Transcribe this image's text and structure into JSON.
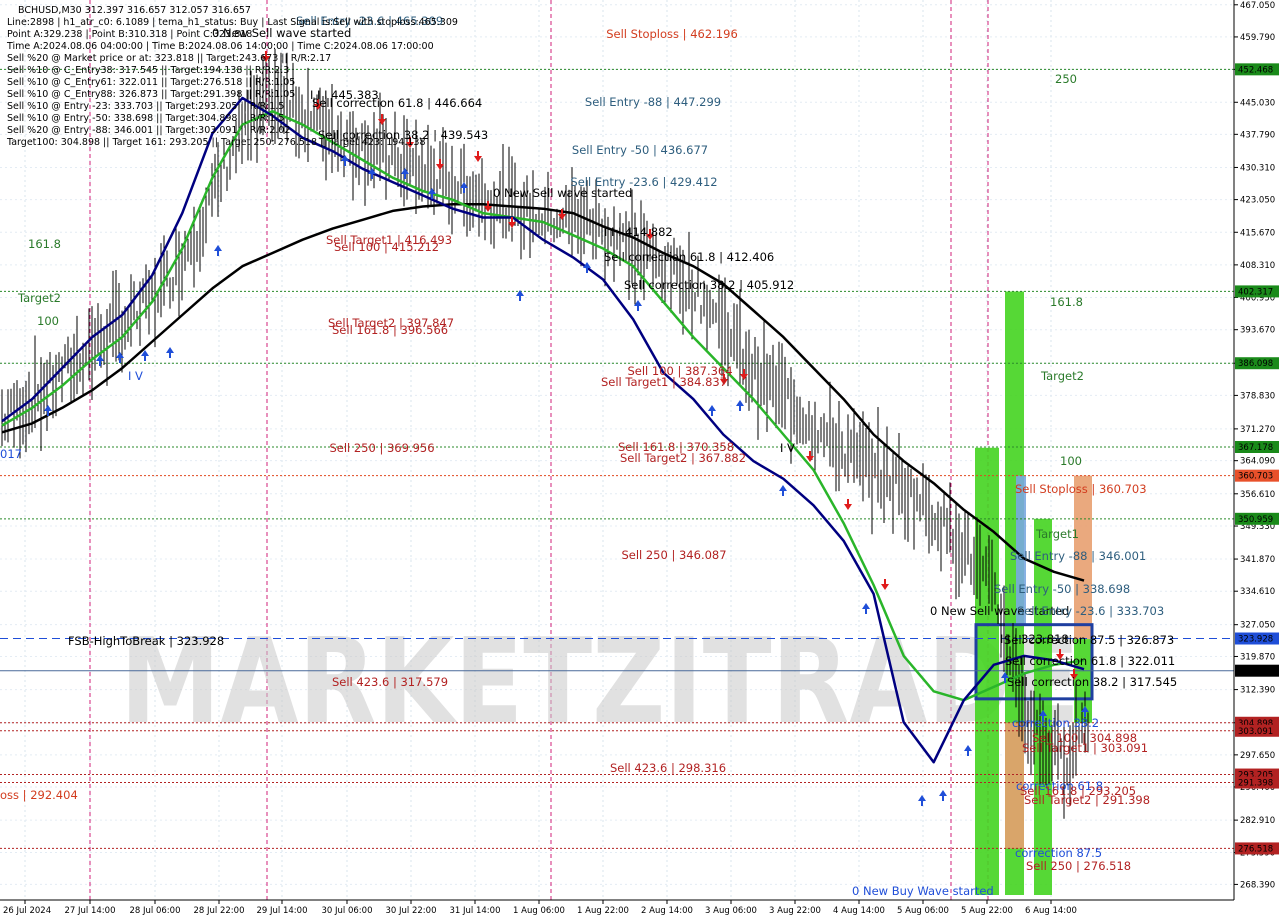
{
  "symbol_header": "BCHUSD,M30  312.397 316.657 312.057 316.657",
  "info_lines": [
    "Line:2898 | h1_atr_c0: 6.1089 | tema_h1_status: Buy | Last Signal is:Sell with stoploss:465.309",
    "Point A:329.238 | Point B:310.318 | Point C:323.818",
    "Time A:2024.08.06 04:00:00 | Time B:2024.08.06 14:00:00 | Time C:2024.08.06 17:00:00",
    "Sell %20 @ Market price or at: 323.818 || Target:243.673 || R/R:2.17",
    "Sell %10 @ C_Entry38: 317.545 || Target:194.138 || R/R:2.3",
    "Sell %10 @ C_Entry61: 322.011 || Target:276.518 || R/R:1.05",
    "Sell %10 @ C_Entry88: 326.873 || Target:291.398 || R/R:1.05",
    "Sell %10 @ Entry -23: 333.703 || Target:293.205 || R/R:1.5",
    "Sell %10 @ Entry -50: 338.698 || Target:304.898 || R/R:1.5",
    "Sell %20 @ Entry -88: 346.001 || Target:303.091 || R/R:2.02",
    "Target100: 304.898 || Target 161: 293.205 || Target 250: 276.518 || Target 423: 194.138"
  ],
  "chart_data": {
    "type": "line",
    "symbol": "BCHUSD",
    "timeframe": "M30",
    "ylim": [
      266,
      467
    ],
    "x_categories": [
      "26 Jul 2024",
      "27 Jul 14:00",
      "28 Jul 06:00",
      "28 Jul 22:00",
      "29 Jul 14:00",
      "30 Jul 06:00",
      "30 Jul 22:00",
      "31 Jul 14:00",
      "1 Aug 06:00",
      "1 Aug 22:00",
      "2 Aug 14:00",
      "3 Aug 06:00",
      "3 Aug 22:00",
      "4 Aug 14:00",
      "5 Aug 06:00",
      "5 Aug 22:00",
      "6 Aug 14:00"
    ],
    "y_ticks": [
      "467.050",
      "459.790",
      "452.460",
      "445.030",
      "437.790",
      "430.310",
      "423.050",
      "415.670",
      "408.310",
      "400.950",
      "393.670",
      "386.098",
      "378.830",
      "371.270",
      "364.090",
      "356.610",
      "349.330",
      "341.870",
      "334.610",
      "327.050",
      "319.870",
      "312.390",
      "304.898",
      "297.650",
      "290.400",
      "282.910",
      "275.590",
      "268.390"
    ],
    "series": [
      {
        "name": "",
        "color": "#000000",
        "y": [
          370.5,
          372.5,
          376,
          380,
          385,
          391,
          397,
          403,
          408,
          411,
          414,
          416.5,
          418.5,
          420.5,
          421.5,
          422,
          422,
          421.5,
          421,
          420,
          417,
          414.5,
          411,
          408,
          404,
          398,
          392,
          385,
          378,
          370,
          364,
          359,
          353,
          348,
          342,
          339,
          337
        ]
      },
      {
        "name": "",
        "color": "#2ab52a",
        "y": [
          372,
          376,
          381,
          387,
          392,
          400,
          412,
          428,
          440,
          443,
          440,
          436,
          432,
          428,
          425,
          423,
          420,
          419,
          418,
          415,
          412,
          408,
          400,
          392,
          385,
          378,
          370,
          362,
          350,
          336,
          320,
          312,
          310,
          313,
          316,
          318,
          319
        ]
      },
      {
        "name": "",
        "color": "#000080",
        "y": [
          373,
          378,
          385,
          392,
          397,
          406,
          420,
          438,
          446,
          442,
          437,
          434,
          430,
          427,
          424,
          421,
          419,
          419,
          414,
          410,
          405,
          396,
          384,
          378,
          370,
          364,
          360,
          354,
          346,
          334,
          305,
          296,
          310,
          318,
          320,
          319,
          317
        ]
      }
    ],
    "right_price_labels": [
      {
        "value": "452.468",
        "color": "#1a8a1a"
      },
      {
        "value": "402.317",
        "color": "#1a8a1a"
      },
      {
        "value": "386.098",
        "color": "#1a8a1a"
      },
      {
        "value": "367.178",
        "color": "#1a8a1a"
      },
      {
        "value": "360.703",
        "color": "#e8502a"
      },
      {
        "value": "350.959",
        "color": "#1a8a1a"
      },
      {
        "value": "323.928",
        "color": "#1f4ed8"
      },
      {
        "value": "316.657",
        "color": "#000000"
      },
      {
        "value": "304.898",
        "color": "#b22222"
      },
      {
        "value": "303.091",
        "color": "#b22222"
      },
      {
        "value": "293.205",
        "color": "#b22222"
      },
      {
        "value": "291.398",
        "color": "#b22222"
      },
      {
        "value": "276.518",
        "color": "#b22222"
      }
    ],
    "annotations": [
      {
        "text": "Sell Entry -23.6 | 465.309",
        "color": "#2e5e7e"
      },
      {
        "text": "0 New Sell wave started",
        "color": "#000000"
      },
      {
        "text": "Sell Stoploss | 462.196",
        "color": "#d23c1e"
      },
      {
        "text": "250",
        "color": "#2a7a2a"
      },
      {
        "text": "Sell Entry -88 | 447.299",
        "color": "#2e5e7e"
      },
      {
        "text": "I I I 445.383",
        "color": "#000000"
      },
      {
        "text": "Sell correction 61.8 | 446.664",
        "color": "#000000"
      },
      {
        "text": "Sell correction 38.2 | 439.543",
        "color": "#000000"
      },
      {
        "text": "Sell Entry -50 | 436.677",
        "color": "#2e5e7e"
      },
      {
        "text": "Sell Entry -23.6 | 429.412",
        "color": "#2e5e7e"
      },
      {
        "text": "0 New Sell wave started",
        "color": "#000000"
      },
      {
        "text": "I I I 414.882",
        "color": "#000000"
      },
      {
        "text": "Sell Target1 | 416.493",
        "color": "#b22222"
      },
      {
        "text": "Sell 100 | 415.212",
        "color": "#b22222"
      },
      {
        "text": "Sell correction 61.8 | 412.406",
        "color": "#000000"
      },
      {
        "text": "Sell correction 38.2 | 405.912",
        "color": "#000000"
      },
      {
        "text": "161.8",
        "color": "#2a7a2a"
      },
      {
        "text": "Target2",
        "color": "#2a7a2a"
      },
      {
        "text": "100",
        "color": "#2a7a2a"
      },
      {
        "text": "Sell Target2 | 397.847",
        "color": "#b22222"
      },
      {
        "text": "Sell 161.8 | 396.566",
        "color": "#b22222"
      },
      {
        "text": "I V",
        "color": "#1f4ed8"
      },
      {
        "text": "Sell 100 | 387.364",
        "color": "#b22222"
      },
      {
        "text": "Sell Target1 | 384.837",
        "color": "#b22222"
      },
      {
        "text": "Sell 250 | 369.956",
        "color": "#b22222"
      },
      {
        "text": "Sell 161.8 | 370.358",
        "color": "#b22222"
      },
      {
        "text": "Sell Target2 | 367.882",
        "color": "#b22222"
      },
      {
        "text": "I V",
        "color": "#000000"
      },
      {
        "text": "161.8",
        "color": "#2a7a2a"
      },
      {
        "text": "Target2",
        "color": "#2a7a2a"
      },
      {
        "text": "100",
        "color": "#2a7a2a"
      },
      {
        "text": "Sell Stoploss | 360.703",
        "color": "#d23c1e"
      },
      {
        "text": "Target1",
        "color": "#2a7a2a"
      },
      {
        "text": "Sell 250 | 346.087",
        "color": "#b22222"
      },
      {
        "text": "Sell Entry -88 | 346.001",
        "color": "#2e5e7e"
      },
      {
        "text": "Sell Entry -50 | 338.698",
        "color": "#2e5e7e"
      },
      {
        "text": "0 New Sell wave started",
        "color": "#000000"
      },
      {
        "text": "Sell Entry -23.6 | 333.703",
        "color": "#2e5e7e"
      },
      {
        "text": "FSB-HighToBreak | 323.928",
        "color": "#000000"
      },
      {
        "text": "I I I 323.818",
        "color": "#000000"
      },
      {
        "text": "Sell correction 87.5 | 326.873",
        "color": "#000000"
      },
      {
        "text": "Sell correction 61.8 | 322.011",
        "color": "#000000"
      },
      {
        "text": "Sell correction 38.2 | 317.545",
        "color": "#000000"
      },
      {
        "text": "Sell 423.6 | 317.579",
        "color": "#b22222"
      },
      {
        "text": "correction 38.2",
        "color": "#1f4ed8"
      },
      {
        "text": "Sell 100 | 304.898",
        "color": "#b22222"
      },
      {
        "text": "Sell Target1 | 303.091",
        "color": "#b22222"
      },
      {
        "text": "Sell 423.6 | 298.316",
        "color": "#b22222"
      },
      {
        "text": "correction 61.8",
        "color": "#1f4ed8"
      },
      {
        "text": "Sell 161.8 | 293.205",
        "color": "#b22222"
      },
      {
        "text": "Sell Target2 | 291.398",
        "color": "#b22222"
      },
      {
        "text": "oss | 292.404",
        "color": "#d23c1e"
      },
      {
        "text": "correction 87.5",
        "color": "#1f4ed8"
      },
      {
        "text": "Sell 250 | 276.518",
        "color": "#b22222"
      },
      {
        "text": "0 New Buy Wave started",
        "color": "#1f4ed8"
      },
      {
        "text": "017",
        "color": "#1f4ed8"
      }
    ],
    "watermark": "MARKETZITRADE"
  }
}
